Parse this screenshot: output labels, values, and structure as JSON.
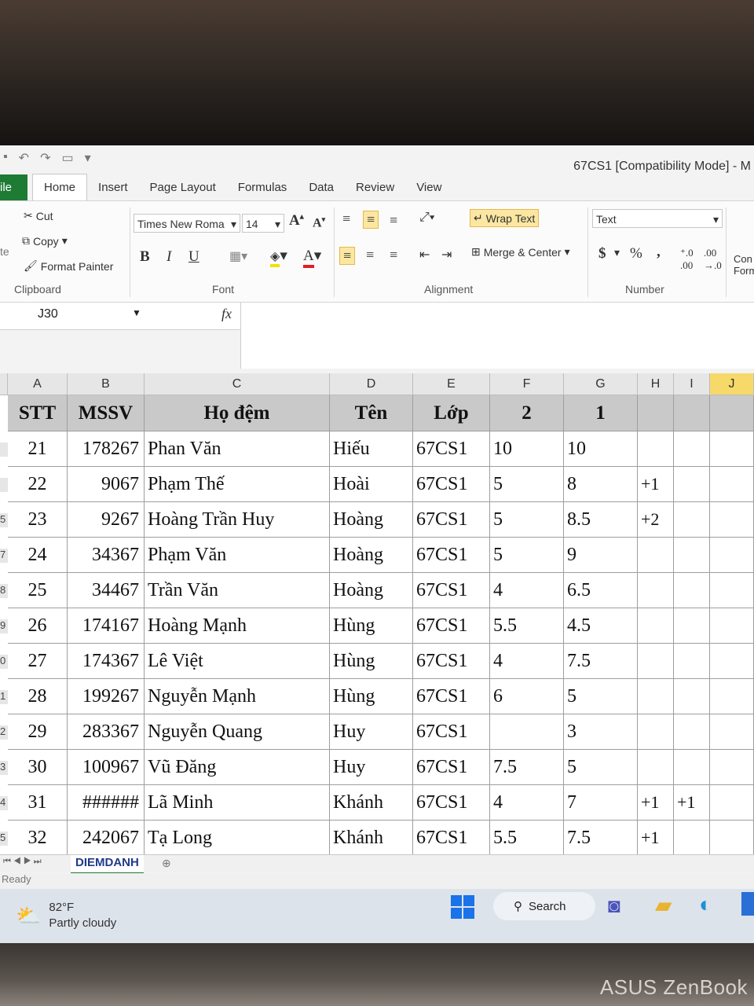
{
  "window": {
    "title": "67CS1  [Compatibility Mode]  -  M"
  },
  "tabs": [
    "ile",
    "Home",
    "Insert",
    "Page Layout",
    "Formulas",
    "Data",
    "Review",
    "View"
  ],
  "ribbon": {
    "clipboard": {
      "paste_fragment": "te",
      "cut": "Cut",
      "copy": "Copy",
      "format_painter": "Format Painter",
      "label": "Clipboard"
    },
    "font": {
      "name": "Times New Roma",
      "size": "14",
      "bold": "B",
      "italic": "I",
      "underline": "U",
      "label": "Font"
    },
    "alignment": {
      "wrap_text": "Wrap Text",
      "merge_center": "Merge & Center",
      "label": "Alignment"
    },
    "number": {
      "format": "Text",
      "currency": "$",
      "percent": "%",
      "comma": ",",
      "label": "Number"
    },
    "styles_fragment": {
      "line1": "Con",
      "line2": "Form"
    }
  },
  "formula_bar": {
    "name_box": "J30",
    "fx": "fx",
    "formula": ""
  },
  "columns": [
    "A",
    "B",
    "C",
    "D",
    "E",
    "F",
    "G",
    "H",
    "I",
    "J"
  ],
  "selected_column": "J",
  "header": {
    "stt": "STT",
    "mssv": "MSSV",
    "ho_dem": "Họ đệm",
    "ten": "Tên",
    "lop": "Lớp",
    "f": "2",
    "g": "1"
  },
  "rows": [
    {
      "rn": "",
      "stt": "21",
      "mssv": "178267",
      "ho_dem": "Phan Văn",
      "ten": "Hiếu",
      "lop": "67CS1",
      "f": "10",
      "g": "10",
      "h": "",
      "i": ""
    },
    {
      "rn": "",
      "stt": "22",
      "mssv": "9067",
      "ho_dem": "Phạm Thế",
      "ten": "Hoài",
      "lop": "67CS1",
      "f": "5",
      "g": "8",
      "h": "+1",
      "i": ""
    },
    {
      "rn": "5",
      "stt": "23",
      "mssv": "9267",
      "ho_dem": "Hoàng Trần Huy",
      "ten": "Hoàng",
      "lop": "67CS1",
      "f": "5",
      "g": "8.5",
      "h": "+2",
      "i": ""
    },
    {
      "rn": "7",
      "stt": "24",
      "mssv": "34367",
      "ho_dem": "Phạm Văn",
      "ten": "Hoàng",
      "lop": "67CS1",
      "f": "5",
      "g": "9",
      "h": "",
      "i": ""
    },
    {
      "rn": "8",
      "stt": "25",
      "mssv": "34467",
      "ho_dem": "Trần Văn",
      "ten": "Hoàng",
      "lop": "67CS1",
      "f": "4",
      "g": "6.5",
      "h": "",
      "i": ""
    },
    {
      "rn": "9",
      "stt": "26",
      "mssv": "174167",
      "ho_dem": "Hoàng Mạnh",
      "ten": "Hùng",
      "lop": "67CS1",
      "f": "5.5",
      "g": "4.5",
      "h": "",
      "i": ""
    },
    {
      "rn": "0",
      "stt": "27",
      "mssv": "174367",
      "ho_dem": "Lê Việt",
      "ten": "Hùng",
      "lop": "67CS1",
      "f": "4",
      "g": "7.5",
      "h": "",
      "i": ""
    },
    {
      "rn": "1",
      "stt": "28",
      "mssv": "199267",
      "ho_dem": "Nguyễn Mạnh",
      "ten": "Hùng",
      "lop": "67CS1",
      "f": "6",
      "g": "5",
      "h": "",
      "i": ""
    },
    {
      "rn": "2",
      "stt": "29",
      "mssv": "283367",
      "ho_dem": "Nguyễn Quang",
      "ten": "Huy",
      "lop": "67CS1",
      "f": "",
      "g": "3",
      "h": "",
      "i": ""
    },
    {
      "rn": "3",
      "stt": "30",
      "mssv": "100967",
      "ho_dem": "Vũ Đăng",
      "ten": "Huy",
      "lop": "67CS1",
      "f": "7.5",
      "g": "5",
      "h": "",
      "i": ""
    },
    {
      "rn": "4",
      "stt": "31",
      "mssv": "######",
      "ho_dem": "Lã Minh",
      "ten": "Khánh",
      "lop": "67CS1",
      "f": "4",
      "g": "7",
      "h": "+1",
      "i": "+1"
    },
    {
      "rn": "5",
      "stt": "32",
      "mssv": "242067",
      "ho_dem": "Tạ Long",
      "ten": "Khánh",
      "lop": "67CS1",
      "f": "5.5",
      "g": "7.5",
      "h": "+1",
      "i": ""
    }
  ],
  "sheet_tab": "DIEMDANH",
  "status": "Ready",
  "taskbar": {
    "temp": "82°F",
    "weather": "Partly cloudy",
    "search": "Search"
  },
  "brand": "ASUS ZenBook",
  "colors": {
    "excel_green": "#1e7b34",
    "header_gray": "#c9c9c9",
    "selected_col": "#f7d96a"
  }
}
